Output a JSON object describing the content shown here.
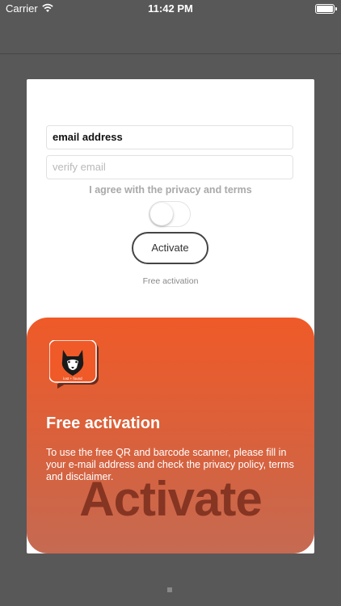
{
  "status_bar": {
    "carrier": "Carrier",
    "time": "11:42 PM",
    "icons": [
      "wifi-icon",
      "battery-icon"
    ]
  },
  "form": {
    "email_value": "email address",
    "verify_placeholder": "verify email",
    "agree_label": "I agree with the privacy and terms",
    "toggle_on": false,
    "activate_button": "Activate",
    "free_activation_note": "Free activation"
  },
  "promo": {
    "logo_icon": "husky-chat-bubble-logo",
    "logo_text": "lost + found",
    "title": "Free activation",
    "description": "To use the free QR and barcode scanner, please fill in your e-mail address and check the privacy policy, terms and disclaimer.",
    "big_text": "Activate"
  },
  "colors": {
    "background": "#595859",
    "accent_orange": "#ef5a28",
    "big_text": "#7a2d1d"
  }
}
